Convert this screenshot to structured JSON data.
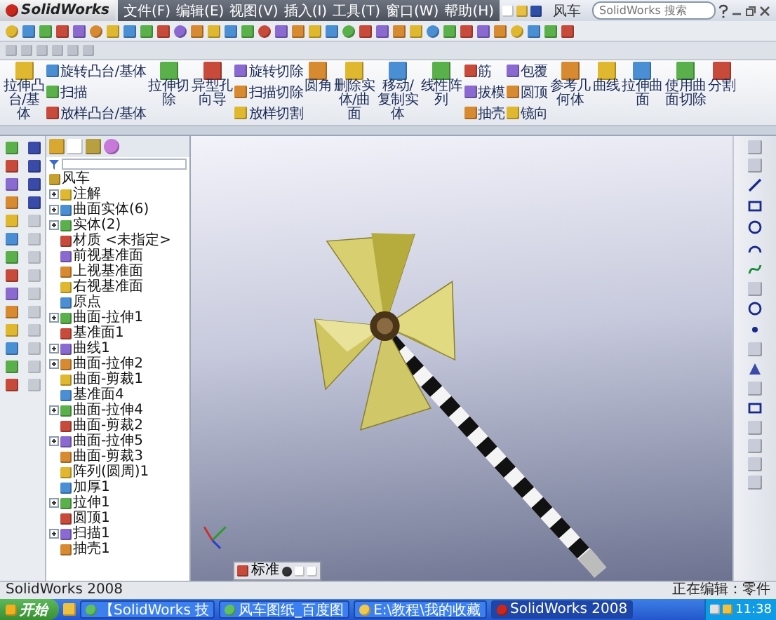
{
  "window": {
    "title": "风车"
  },
  "app_name": "SolidWorks",
  "menu": [
    "文件(F)",
    "编辑(E)",
    "视图(V)",
    "插入(I)",
    "工具(T)",
    "窗口(W)",
    "帮助(H)"
  ],
  "search": {
    "placeholder": "SolidWorks 搜索"
  },
  "ribbon": [
    {
      "kind": "large",
      "label": "拉伸凸台/基体"
    },
    {
      "kind": "stack",
      "items": [
        "旋转凸台/基体",
        "扫描",
        "放样凸台/基体"
      ]
    },
    {
      "kind": "large",
      "label": "拉伸切除"
    },
    {
      "kind": "large",
      "label": "异型孔向导"
    },
    {
      "kind": "stack",
      "items": [
        "旋转切除",
        "扫描切除",
        "放样切割"
      ]
    },
    {
      "kind": "large",
      "label": "圆角"
    },
    {
      "kind": "large",
      "label": "删除实体/曲面"
    },
    {
      "kind": "large",
      "label": "移动/复制实体"
    },
    {
      "kind": "large",
      "label": "线性阵列"
    },
    {
      "kind": "stack",
      "items": [
        "筋",
        "拔模",
        "抽壳"
      ]
    },
    {
      "kind": "stack",
      "items": [
        "包覆",
        "圆顶",
        "镜向"
      ]
    },
    {
      "kind": "large",
      "label": "参考几何体"
    },
    {
      "kind": "large",
      "label": "曲线"
    },
    {
      "kind": "large",
      "label": "拉伸曲面"
    },
    {
      "kind": "large",
      "label": "使用曲面切除"
    },
    {
      "kind": "large",
      "label": "分割"
    }
  ],
  "tree": {
    "root": {
      "label": "风车",
      "children": [
        {
          "label": "注解",
          "expander": true
        },
        {
          "label": "曲面实体(6)",
          "expander": true
        },
        {
          "label": "实体(2)",
          "expander": true
        },
        {
          "label": "材质 <未指定>",
          "expander": false
        },
        {
          "label": "前视基准面",
          "expander": false
        },
        {
          "label": "上视基准面",
          "expander": false
        },
        {
          "label": "右视基准面",
          "expander": false
        },
        {
          "label": "原点",
          "expander": false
        },
        {
          "label": "曲面-拉伸1",
          "expander": true
        },
        {
          "label": "基准面1",
          "expander": false
        },
        {
          "label": "曲线1",
          "expander": true
        },
        {
          "label": "曲面-拉伸2",
          "expander": true
        },
        {
          "label": "曲面-剪裁1",
          "expander": false
        },
        {
          "label": "基准面4",
          "expander": false
        },
        {
          "label": "曲面-拉伸4",
          "expander": true
        },
        {
          "label": "曲面-剪裁2",
          "expander": false
        },
        {
          "label": "曲面-拉伸5",
          "expander": true
        },
        {
          "label": "曲面-剪裁3",
          "expander": false
        },
        {
          "label": "阵列(圆周)1",
          "expander": false
        },
        {
          "label": "加厚1",
          "expander": false
        },
        {
          "label": "拉伸1",
          "expander": true
        },
        {
          "label": "圆顶1",
          "expander": false
        },
        {
          "label": "扫描1",
          "expander": true
        },
        {
          "label": "抽壳1",
          "expander": false
        }
      ]
    }
  },
  "floating_toolbar": {
    "title": "标准"
  },
  "status_bar": {
    "left": "SolidWorks 2008",
    "right": "正在编辑：零件"
  },
  "taskbar": {
    "start": "开始",
    "tasks": [
      {
        "label": "【SolidWorks 技",
        "selected": false
      },
      {
        "label": "风车图纸_百度图",
        "selected": false
      },
      {
        "label": "E:\\教程\\我的收藏",
        "selected": false
      },
      {
        "label": "SolidWorks 2008",
        "selected": true
      }
    ],
    "clock": "11:38"
  }
}
